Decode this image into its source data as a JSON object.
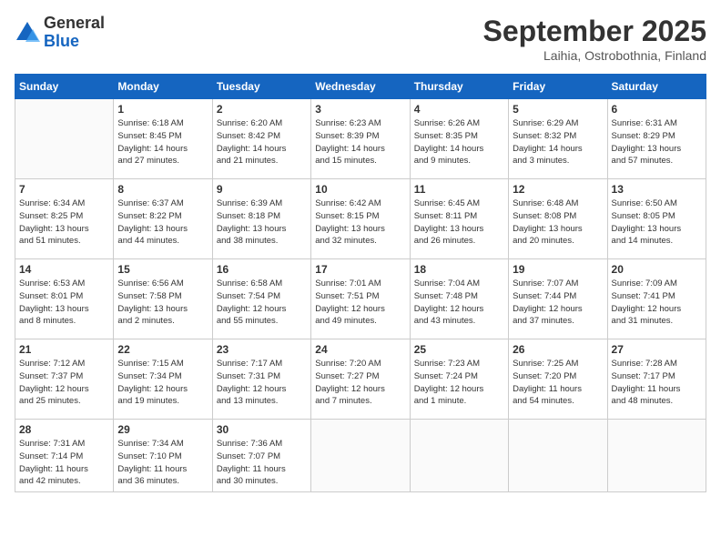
{
  "header": {
    "logo": {
      "general": "General",
      "blue": "Blue"
    },
    "title": "September 2025",
    "subtitle": "Laihia, Ostrobothnia, Finland"
  },
  "calendar": {
    "days_of_week": [
      "Sunday",
      "Monday",
      "Tuesday",
      "Wednesday",
      "Thursday",
      "Friday",
      "Saturday"
    ],
    "weeks": [
      [
        {
          "day": "",
          "info": ""
        },
        {
          "day": "1",
          "info": "Sunrise: 6:18 AM\nSunset: 8:45 PM\nDaylight: 14 hours\nand 27 minutes."
        },
        {
          "day": "2",
          "info": "Sunrise: 6:20 AM\nSunset: 8:42 PM\nDaylight: 14 hours\nand 21 minutes."
        },
        {
          "day": "3",
          "info": "Sunrise: 6:23 AM\nSunset: 8:39 PM\nDaylight: 14 hours\nand 15 minutes."
        },
        {
          "day": "4",
          "info": "Sunrise: 6:26 AM\nSunset: 8:35 PM\nDaylight: 14 hours\nand 9 minutes."
        },
        {
          "day": "5",
          "info": "Sunrise: 6:29 AM\nSunset: 8:32 PM\nDaylight: 14 hours\nand 3 minutes."
        },
        {
          "day": "6",
          "info": "Sunrise: 6:31 AM\nSunset: 8:29 PM\nDaylight: 13 hours\nand 57 minutes."
        }
      ],
      [
        {
          "day": "7",
          "info": "Sunrise: 6:34 AM\nSunset: 8:25 PM\nDaylight: 13 hours\nand 51 minutes."
        },
        {
          "day": "8",
          "info": "Sunrise: 6:37 AM\nSunset: 8:22 PM\nDaylight: 13 hours\nand 44 minutes."
        },
        {
          "day": "9",
          "info": "Sunrise: 6:39 AM\nSunset: 8:18 PM\nDaylight: 13 hours\nand 38 minutes."
        },
        {
          "day": "10",
          "info": "Sunrise: 6:42 AM\nSunset: 8:15 PM\nDaylight: 13 hours\nand 32 minutes."
        },
        {
          "day": "11",
          "info": "Sunrise: 6:45 AM\nSunset: 8:11 PM\nDaylight: 13 hours\nand 26 minutes."
        },
        {
          "day": "12",
          "info": "Sunrise: 6:48 AM\nSunset: 8:08 PM\nDaylight: 13 hours\nand 20 minutes."
        },
        {
          "day": "13",
          "info": "Sunrise: 6:50 AM\nSunset: 8:05 PM\nDaylight: 13 hours\nand 14 minutes."
        }
      ],
      [
        {
          "day": "14",
          "info": "Sunrise: 6:53 AM\nSunset: 8:01 PM\nDaylight: 13 hours\nand 8 minutes."
        },
        {
          "day": "15",
          "info": "Sunrise: 6:56 AM\nSunset: 7:58 PM\nDaylight: 13 hours\nand 2 minutes."
        },
        {
          "day": "16",
          "info": "Sunrise: 6:58 AM\nSunset: 7:54 PM\nDaylight: 12 hours\nand 55 minutes."
        },
        {
          "day": "17",
          "info": "Sunrise: 7:01 AM\nSunset: 7:51 PM\nDaylight: 12 hours\nand 49 minutes."
        },
        {
          "day": "18",
          "info": "Sunrise: 7:04 AM\nSunset: 7:48 PM\nDaylight: 12 hours\nand 43 minutes."
        },
        {
          "day": "19",
          "info": "Sunrise: 7:07 AM\nSunset: 7:44 PM\nDaylight: 12 hours\nand 37 minutes."
        },
        {
          "day": "20",
          "info": "Sunrise: 7:09 AM\nSunset: 7:41 PM\nDaylight: 12 hours\nand 31 minutes."
        }
      ],
      [
        {
          "day": "21",
          "info": "Sunrise: 7:12 AM\nSunset: 7:37 PM\nDaylight: 12 hours\nand 25 minutes."
        },
        {
          "day": "22",
          "info": "Sunrise: 7:15 AM\nSunset: 7:34 PM\nDaylight: 12 hours\nand 19 minutes."
        },
        {
          "day": "23",
          "info": "Sunrise: 7:17 AM\nSunset: 7:31 PM\nDaylight: 12 hours\nand 13 minutes."
        },
        {
          "day": "24",
          "info": "Sunrise: 7:20 AM\nSunset: 7:27 PM\nDaylight: 12 hours\nand 7 minutes."
        },
        {
          "day": "25",
          "info": "Sunrise: 7:23 AM\nSunset: 7:24 PM\nDaylight: 12 hours\nand 1 minute."
        },
        {
          "day": "26",
          "info": "Sunrise: 7:25 AM\nSunset: 7:20 PM\nDaylight: 11 hours\nand 54 minutes."
        },
        {
          "day": "27",
          "info": "Sunrise: 7:28 AM\nSunset: 7:17 PM\nDaylight: 11 hours\nand 48 minutes."
        }
      ],
      [
        {
          "day": "28",
          "info": "Sunrise: 7:31 AM\nSunset: 7:14 PM\nDaylight: 11 hours\nand 42 minutes."
        },
        {
          "day": "29",
          "info": "Sunrise: 7:34 AM\nSunset: 7:10 PM\nDaylight: 11 hours\nand 36 minutes."
        },
        {
          "day": "30",
          "info": "Sunrise: 7:36 AM\nSunset: 7:07 PM\nDaylight: 11 hours\nand 30 minutes."
        },
        {
          "day": "",
          "info": ""
        },
        {
          "day": "",
          "info": ""
        },
        {
          "day": "",
          "info": ""
        },
        {
          "day": "",
          "info": ""
        }
      ]
    ]
  }
}
